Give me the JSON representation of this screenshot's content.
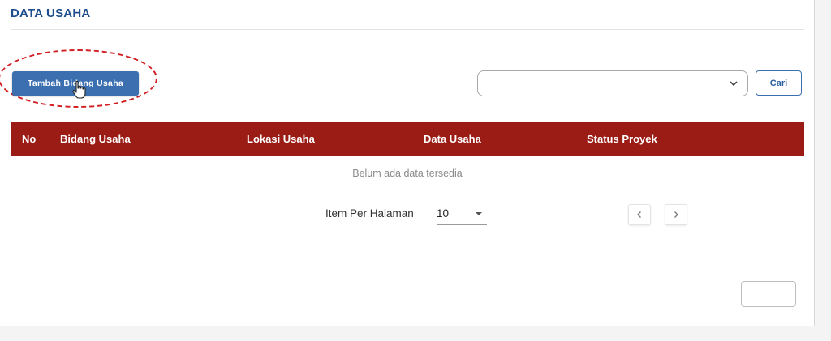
{
  "page": {
    "title": "DATA USAHA"
  },
  "toolbar": {
    "add_button_label": "Tambah Bidang Usaha",
    "filter_select_value": "",
    "search_button_label": "Cari"
  },
  "table": {
    "columns": [
      "No",
      "Bidang Usaha",
      "Lokasi Usaha",
      "Data Usaha",
      "Status Proyek"
    ],
    "empty_message": "Belum ada data tersedia"
  },
  "pagination": {
    "per_page_label": "Item Per Halaman",
    "per_page_value": "10"
  },
  "colors": {
    "title": "#1f4e8c",
    "primary_button": "#3b6fb0",
    "table_header": "#9b1c15",
    "highlight": "#d21f24"
  },
  "icons": {
    "cursor": "hand-pointer-icon",
    "select_arrow": "chevron-down-icon",
    "prev": "chevron-left-icon",
    "next": "chevron-right-icon"
  }
}
